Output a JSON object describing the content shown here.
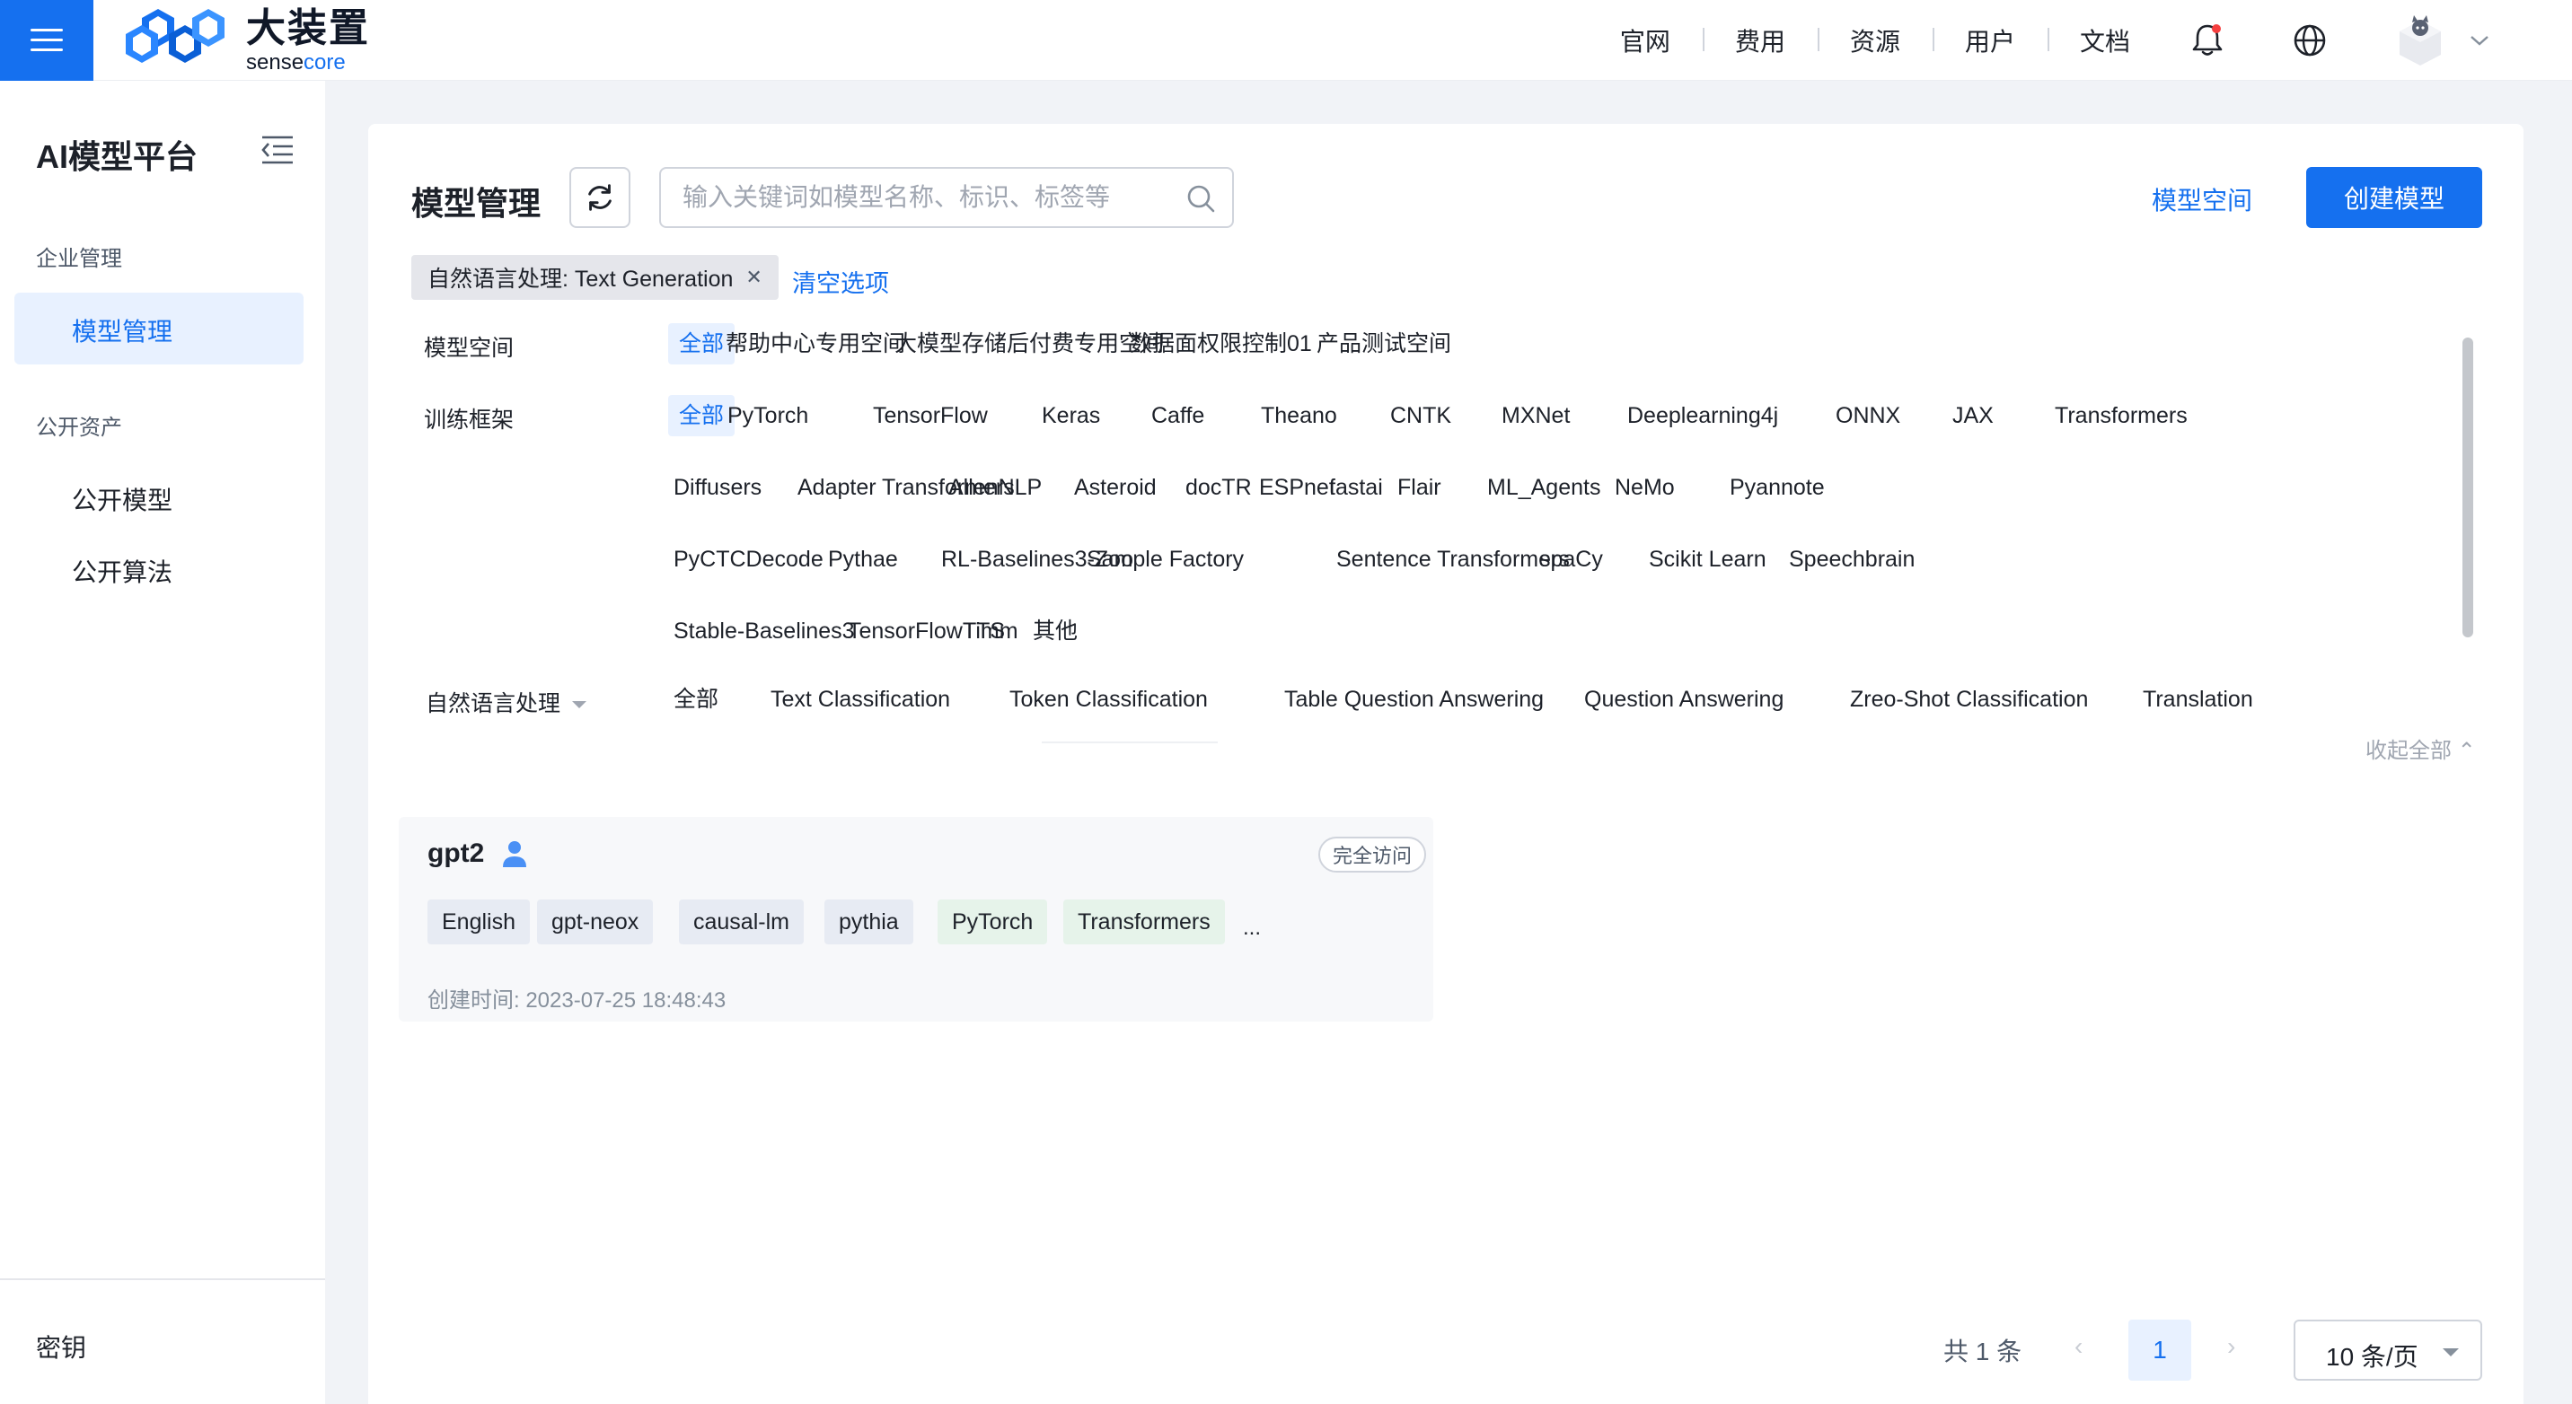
{
  "brand": {
    "name_cn": "大装置",
    "name_en_prefix": "sense",
    "name_en_suffix": "core"
  },
  "topnav": {
    "items": [
      "官网",
      "费用",
      "资源",
      "用户",
      "文档"
    ]
  },
  "sidebar": {
    "title": "AI模型平台",
    "group_enterprise": "企业管理",
    "active_item": "模型管理",
    "group_public": "公开资产",
    "public_items": [
      "公开模型",
      "公开算法"
    ],
    "footer_item": "密钥"
  },
  "main": {
    "title": "模型管理",
    "search_placeholder": "输入关键词如模型名称、标识、标签等",
    "link_space": "模型空间",
    "create_button": "创建模型",
    "active_filter": "自然语言处理: Text Generation",
    "clear_link": "清空选项",
    "collapse_all": "收起全部"
  },
  "filters": {
    "space": {
      "label": "模型空间",
      "items": [
        "全部",
        "帮助中心专用空间",
        "大模型存储后付费专用空间",
        "数据面权限控制01",
        "产品测试空间"
      ]
    },
    "framework": {
      "label": "训练框架",
      "rows": [
        [
          "全部",
          "PyTorch",
          "TensorFlow",
          "Keras",
          "Caffe",
          "Theano",
          "CNTK",
          "MXNet",
          "Deeplearning4j",
          "ONNX",
          "JAX",
          "Transformers"
        ],
        [
          "Diffusers",
          "Adapter Transformers",
          "AllenNLP",
          "Asteroid",
          "docTR",
          "ESPnet",
          "fastai",
          "Flair",
          "ML_Agents",
          "NeMo",
          "Pyannote"
        ],
        [
          "PyCTCDecode",
          "Pythae",
          "RL-Baselines3-Zoo",
          "Sample Factory",
          "Sentence Transformers",
          "spaCy",
          "Scikit Learn",
          "Speechbrain"
        ],
        [
          "Stable-Baselines3",
          "TensorFlowTTS",
          "Timm",
          "其他"
        ]
      ]
    },
    "nlp": {
      "label": "自然语言处理",
      "items": [
        "全部",
        "Text Classification",
        "Token Classification",
        "Table Question Answering",
        "Question Answering",
        "Zreo-Shot Classification",
        "Translation"
      ]
    }
  },
  "model": {
    "name": "gpt2",
    "access": "完全访问",
    "tags": [
      "English",
      "gpt-neox",
      "causal-lm",
      "pythia",
      "PyTorch",
      "Transformers"
    ],
    "more": "...",
    "created": "创建时间: 2023-07-25 18:48:43"
  },
  "pagination": {
    "total": "共 1 条",
    "prev": "‹",
    "current": "1",
    "next": "›",
    "page_size": "10 条/页"
  },
  "colors": {
    "accent": "#1570ef",
    "active_bg": "#e8f1ff",
    "tag_bg": "#e7ebf3",
    "tag_green_bg": "#e6f3ea"
  }
}
